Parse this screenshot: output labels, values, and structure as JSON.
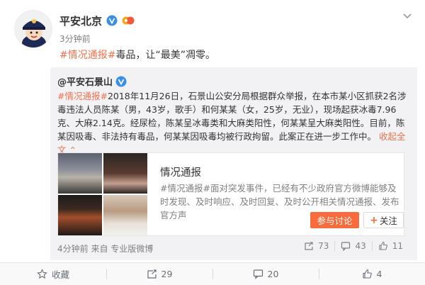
{
  "post": {
    "author": "平安北京",
    "time": "3分钟前",
    "topic": "#情况通报#",
    "text": "毒品，让“最美”凋零。"
  },
  "repost": {
    "author": "@平安石景山",
    "topic": "#情况通报#",
    "text": "2018年11月26日，石景山公安分局根据群众举报，在本市某小区抓获2名涉毒违法人员陈某（男，43岁，歌手）和何某某（女，25岁，无业），现场起获冰毒7.96克、大麻2.14克。经尿检，陈某呈冰毒类和大麻类阳性，何某某呈大麻类阳性。目前，陈某因吸毒、非法持有毒品，何某某因吸毒均被行政拘留。此案正在进一步工作中。",
    "expand": "收起全文",
    "card": {
      "title": "情况通报",
      "desc": "#情况通报#面对突发事件，已经有不少政府官方微博能够及时发现、及时响应、及时回复、及时公开相关情况通报、发布官方声",
      "join_label": "参与讨论",
      "follow_label": "关注"
    },
    "meta": "4分钟前 来自 专业版微博",
    "stats": {
      "reposts": "73",
      "comments": "43",
      "likes": "11"
    }
  },
  "actions": {
    "favorite": "收藏",
    "repost": "29",
    "comment": "20",
    "like": "4"
  },
  "colors": {
    "accent": "#eb7350",
    "button": "#f86b3c",
    "verified": "#f7a51c"
  }
}
